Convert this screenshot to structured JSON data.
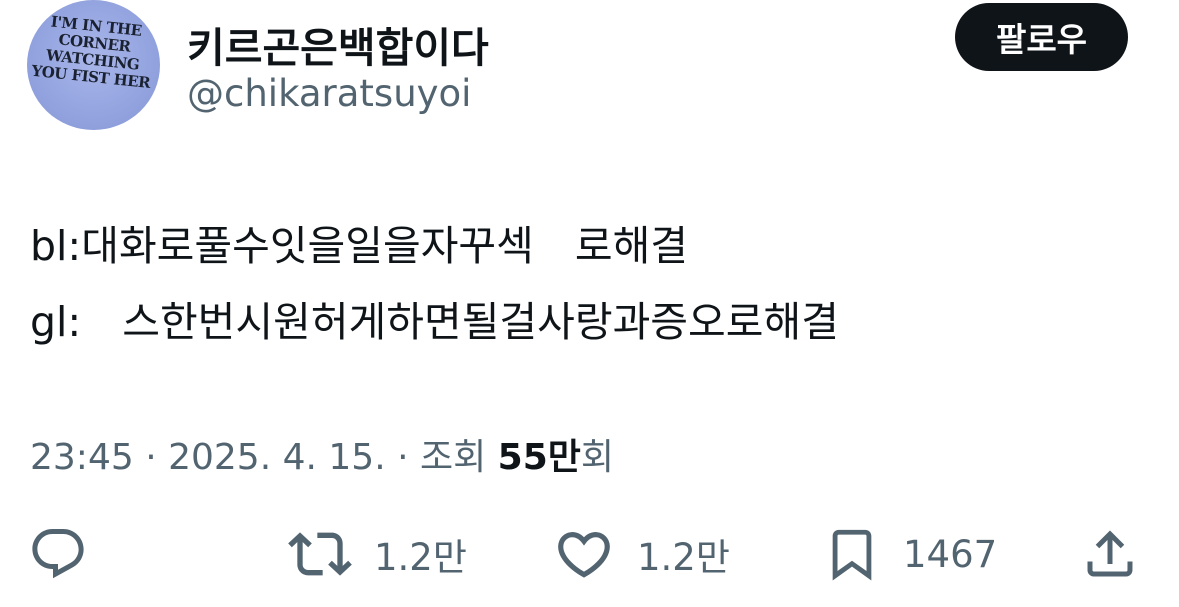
{
  "user": {
    "display_name": "키르곤은백합이다",
    "handle": "@chikaratsuyoi",
    "avatar_text": [
      "I'M IN THE",
      "CORNER",
      "WATCHING",
      "YOU FIST HER"
    ]
  },
  "follow_label": "팔로우",
  "tweet": {
    "line1": "bl:대화로풀수잇을일을자꾸섹　로해결",
    "line2": "gl:　스한번시원허게하면될걸사랑과증오로해결"
  },
  "meta": {
    "time": "23:45",
    "sep1": " · ",
    "date": "2025. 4. 15.",
    "sep2": " · ",
    "views_label": "조회 ",
    "views_count": "55만",
    "views_suffix": "회"
  },
  "actions": {
    "reply_icon": "reply-icon",
    "retweet_count": "1.2만",
    "like_count": "1.2만",
    "bookmark_count": "1467",
    "share_icon": "share-icon"
  },
  "colors": {
    "text": "#0f1419",
    "secondary": "#536471",
    "follow_bg": "#0f1419",
    "avatar_bg": "#9aa9e3"
  }
}
